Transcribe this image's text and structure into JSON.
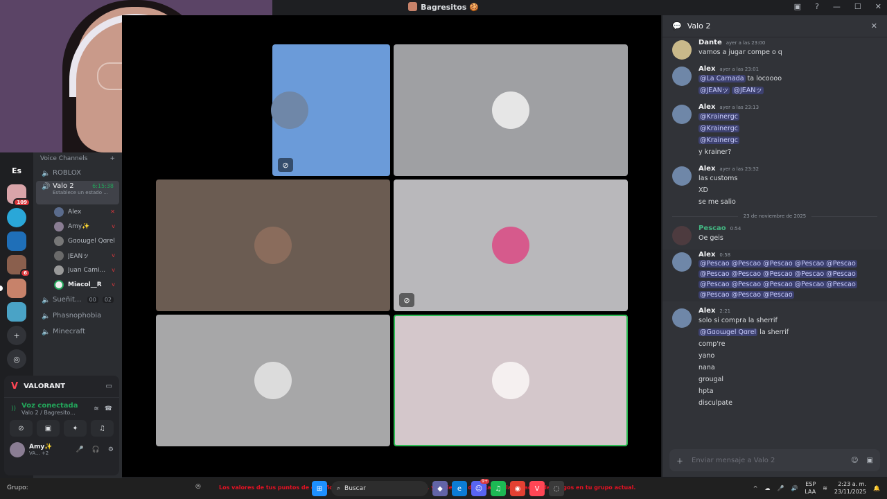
{
  "window": {
    "title": "Bagresitos 🍪"
  },
  "guilds": {
    "es_label": "Es",
    "badge_count": "109",
    "badge_small": "6"
  },
  "channels": {
    "voice_category": "Voice Channels",
    "items": [
      {
        "name": "ROBLOX"
      },
      {
        "name": "Valo 2",
        "time": "6:15:38",
        "status": "Establece un estado ..."
      },
      {
        "name": "Sueñit...",
        "count_a": "00",
        "count_b": "02"
      },
      {
        "name": "Phasnophobia"
      },
      {
        "name": "Minecraft"
      }
    ],
    "members": [
      "Alex",
      "Amy✨",
      "Gɑoɯgel Qɑrel",
      "JEANッ",
      "Juan Cami...",
      "Miacol__R"
    ]
  },
  "voice_panel": {
    "game": "VALORANT",
    "connected": "Voz conectada",
    "location": "Valo 2 / Bagresito...",
    "user": "Amy✨",
    "user_status": "VA... +2"
  },
  "chat": {
    "channel": "Valo 2",
    "messages": [
      {
        "author": "Dante",
        "time": "ayer a las 23:00",
        "lines": [
          "vamos a jugar compe o q"
        ]
      },
      {
        "author": "Alex",
        "time": "ayer a las 23:01",
        "lines": [
          "@La Carnada ta locoooo",
          "@JEANッ @JEANッ"
        ]
      },
      {
        "author": "Alex",
        "time": "ayer a las 23:13",
        "lines": [
          "@Krainergc",
          "@Krainergc",
          "@Krainergc",
          "y krainer?"
        ]
      },
      {
        "author": "Alex",
        "time": "ayer a las 23:32",
        "lines": [
          "las customs",
          "XD",
          "se me salio"
        ]
      },
      {
        "author": "Pescao",
        "time": "0:54",
        "lines": [
          "Oe geis"
        ]
      },
      {
        "author": "Alex",
        "time": "0:58",
        "lines": [
          "@Pescao @Pescao @Pescao @Pescao @Pescao",
          "@Pescao @Pescao @Pescao @Pescao @Pescao",
          "@Pescao @Pescao @Pescao @Pescao @Pescao",
          "@Pescao @Pescao @Pescao"
        ]
      },
      {
        "author": "Alex",
        "time": "2:21",
        "lines": [
          "solo si compra la sherrif",
          "@Gɑoɯgel Qɑrel la sherrif",
          "comp're",
          "yano",
          "nana",
          "grougal",
          "hpta",
          "disculpate"
        ]
      }
    ],
    "date_divider": "23 de noviembre de 2025",
    "composer_placeholder": "Enviar mensaje a Valo 2"
  },
  "taskbar": {
    "group_label": "Grupo:",
    "ticker": "Los valores de tus puntos de clasificación serán un 25% más bajos, y el tiempo de baja de clasificación de rangos en tu grupo actual.",
    "search": "Buscar",
    "lang": "ESP",
    "lang2": "LAA",
    "time": "2:23 a. m.",
    "date": "23/11/2025",
    "notif_badge": "9+"
  },
  "colors": {
    "accent": "#5865f2",
    "online": "#23a55a",
    "tile_blue": "#6b9bd9",
    "speaking": "#2dbd54"
  }
}
